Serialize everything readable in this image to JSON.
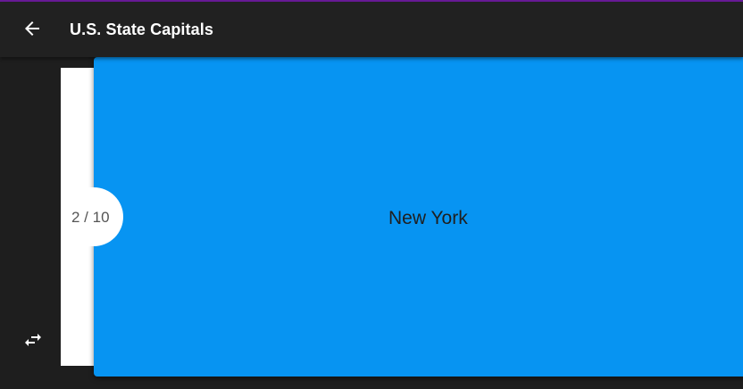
{
  "header": {
    "title": "U.S. State Capitals",
    "back_icon": "arrow-left-icon"
  },
  "card": {
    "text": "New York",
    "color": "#0794f2"
  },
  "pager": {
    "counter": "2 / 10",
    "current": 2,
    "total": 10
  },
  "controls": {
    "swap_icon": "swap-horizontal-icon"
  },
  "colors": {
    "background": "#1e1e1e",
    "app_bar": "#212121",
    "accent_line": "#6a1b9a"
  }
}
